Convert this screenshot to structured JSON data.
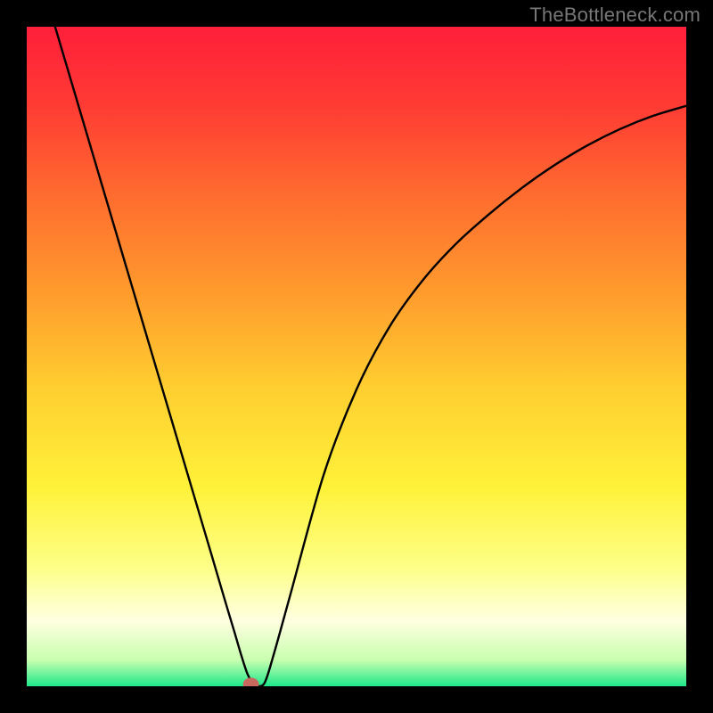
{
  "watermark": "TheBottleneck.com",
  "chart_data": {
    "type": "line",
    "title": "",
    "xlabel": "",
    "ylabel": "",
    "xlim": [
      0,
      1
    ],
    "ylim": [
      0,
      1
    ],
    "gradient_stops": [
      {
        "offset": 0.0,
        "color": "#ff1f3a"
      },
      {
        "offset": 0.12,
        "color": "#ff3b34"
      },
      {
        "offset": 0.25,
        "color": "#ff6a2f"
      },
      {
        "offset": 0.4,
        "color": "#ff9a2d"
      },
      {
        "offset": 0.55,
        "color": "#ffcf30"
      },
      {
        "offset": 0.7,
        "color": "#fff23a"
      },
      {
        "offset": 0.82,
        "color": "#fdff87"
      },
      {
        "offset": 0.9,
        "color": "#ffffe0"
      },
      {
        "offset": 0.96,
        "color": "#c9ffb0"
      },
      {
        "offset": 1.0,
        "color": "#1ee88a"
      }
    ],
    "series": [
      {
        "name": "curve",
        "color": "#000000",
        "x": [
          0.043,
          0.08,
          0.12,
          0.16,
          0.2,
          0.24,
          0.28,
          0.3,
          0.315,
          0.325,
          0.335,
          0.345,
          0.36,
          0.375,
          0.4,
          0.45,
          0.5,
          0.55,
          0.6,
          0.65,
          0.7,
          0.75,
          0.8,
          0.85,
          0.9,
          0.95,
          1.0
        ],
        "y": [
          1.0,
          0.875,
          0.74,
          0.605,
          0.47,
          0.335,
          0.2,
          0.132,
          0.082,
          0.048,
          0.018,
          0.003,
          0.004,
          0.05,
          0.14,
          0.32,
          0.45,
          0.545,
          0.615,
          0.67,
          0.715,
          0.755,
          0.79,
          0.82,
          0.845,
          0.865,
          0.88
        ]
      }
    ],
    "marker": {
      "x": 0.34,
      "y": 0.003,
      "rx": 0.012,
      "ry": 0.01,
      "color": "#c9685f"
    }
  }
}
